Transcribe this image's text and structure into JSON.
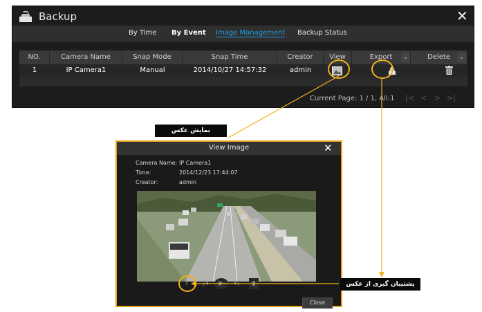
{
  "backup_window": {
    "title": "Backup",
    "close_symbol": "✕",
    "tabs": [
      "By Time",
      "By Event",
      "Image Management",
      "Backup Status"
    ],
    "active_tab": "Image Management",
    "table": {
      "headers": [
        "NO.",
        "Camera Name",
        "Snap Mode",
        "Snap Time",
        "Creator",
        "View",
        "Export",
        "Delete"
      ],
      "rows": [
        {
          "no": "1",
          "camera": "IP Camera1",
          "mode": "Manual",
          "time": "2014/10/27 14:57:32",
          "creator": "admin"
        }
      ]
    },
    "page_info": "Current Page: 1 / 1, All:1",
    "pager": [
      "|<",
      "<",
      ">",
      ">|"
    ]
  },
  "view_dialog": {
    "title": "View Image",
    "close_symbol": "✕",
    "camera_label": "Camera Name:",
    "camera_value": "IP Camera1",
    "time_label": "Time:",
    "time_value": "2014/12/23 17:44:07",
    "creator_label": "Creator:",
    "creator_value": "admin",
    "close_button": "Close"
  },
  "callouts": {
    "view": "نمایش عکس",
    "export": "پشتیبان گیری از عکس"
  },
  "colors": {
    "accent": "#1fa3e6",
    "callout_ring": "#f2b21c",
    "window_bg": "#1c1c1c"
  }
}
